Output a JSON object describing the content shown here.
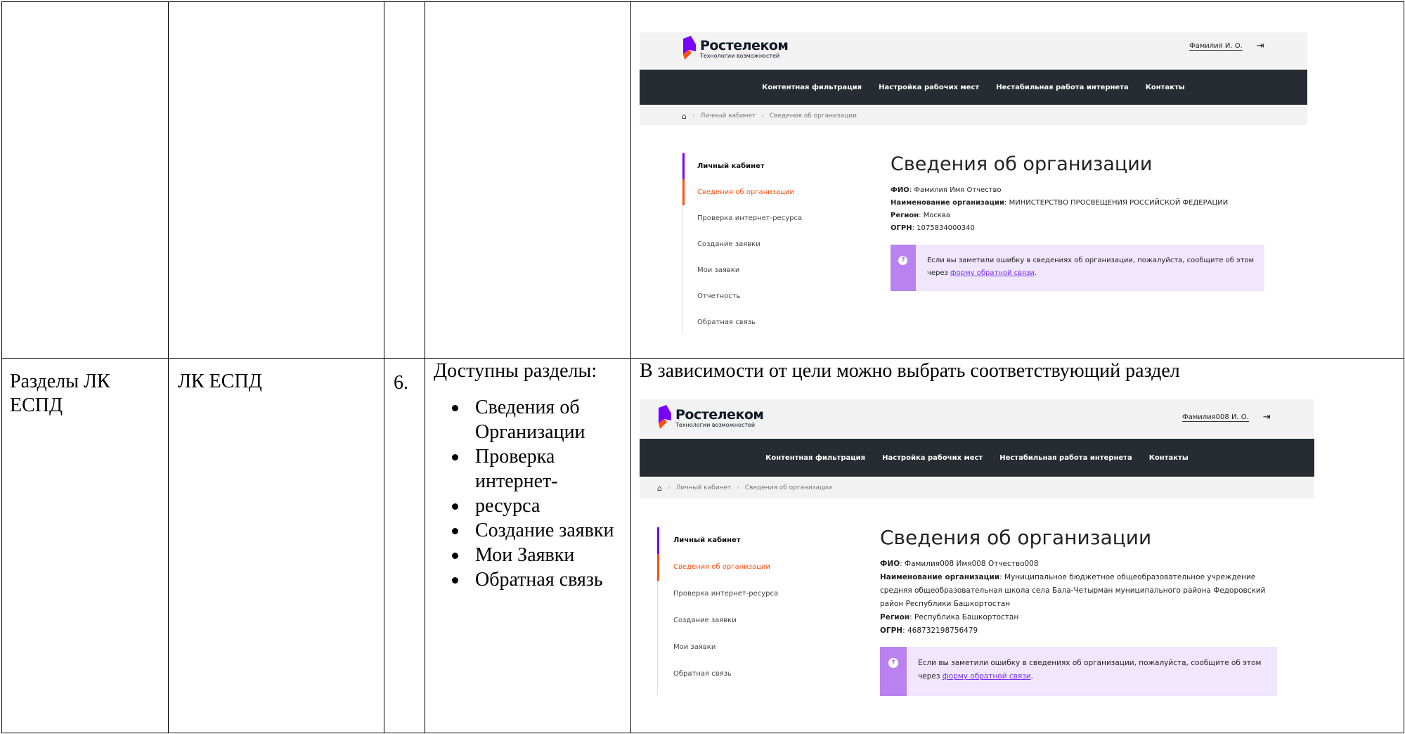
{
  "row1": {
    "shot": {
      "logo_name": "Ростелеком",
      "logo_sub": "Технологии возможностей",
      "user": "Фамилия И. О.",
      "nav": [
        "Контентная фильтрация",
        "Настройка рабочих мест",
        "Нестабильная работа интернета",
        "Контакты"
      ],
      "crumbs": [
        "Личный кабинет",
        "Сведения об организации"
      ],
      "side": [
        "Личный кабинет",
        "Сведения об организации",
        "Проверка интернет-ресурса",
        "Создание заявки",
        "Мои заявки",
        "Отчетность",
        "Обратная связь"
      ],
      "title": "Сведения об организации",
      "fields": [
        {
          "label": "ФИО",
          "value": "Фамилия Имя Отчество"
        },
        {
          "label": "Наименование организации",
          "value": "МИНИСТЕРСТВО ПРОСВЕЩЕНИЯ РОССИЙСКОЙ ФЕДЕРАЦИИ"
        },
        {
          "label": "Регион",
          "value": "Москва"
        },
        {
          "label": "ОГРН",
          "value": "1075834000340"
        }
      ],
      "note_text": "Если вы заметили ошибку в сведениях об организации, пожалуйста, сообщите об этом через ",
      "note_link": "форму обратной связи",
      "note_end": "."
    }
  },
  "row2": {
    "col1": "Разделы ЛК ЕСПД",
    "col2": "ЛК ЕСПД",
    "col3": "6.",
    "col4_heading": "Доступны разделы:",
    "col4_items": [
      "Сведения об Организации",
      "Проверка интернет-",
      "ресурса",
      "Создание заявки",
      "Мои Заявки",
      "Обратная связь"
    ],
    "col5_text": "В зависимости от цели можно выбрать соответствующий раздел",
    "shot": {
      "logo_name": "Ростелеком",
      "logo_sub": "Технологии возможностей",
      "user": "Фамилия008 И. О.",
      "nav": [
        "Контентная фильтрация",
        "Настройка рабочих мест",
        "Нестабильная работа интернета",
        "Контакты"
      ],
      "crumbs": [
        "Личный кабинет",
        "Сведения об организации"
      ],
      "side": [
        "Личный кабинет",
        "Сведения об организации",
        "Проверка интернет-ресурса",
        "Создание заявки",
        "Мои заявки",
        "Обратная связь"
      ],
      "title": "Сведения об организации",
      "fields": [
        {
          "label": "ФИО",
          "value": "Фамилия008 Имя008 Отчество008"
        },
        {
          "label": "Наименование организации",
          "value": "Муниципальное бюджетное общеобразовательное учреждение средняя общеобразовательная школа села Бала-Четырман муниципального района Федоровский район Республики Башкортостан"
        },
        {
          "label": "Регион",
          "value": "Республика Башкортостан"
        },
        {
          "label": "ОГРН",
          "value": "468732198756479"
        }
      ],
      "note_text": "Если вы заметили ошибку в сведениях об организации, пожалуйста, сообщите об этом через ",
      "note_link": "форму обратной связи",
      "note_end": "."
    }
  },
  "colors": {
    "brand_orange": "#ff4f12",
    "brand_purple": "#7700ff",
    "nav_dark": "#272c33",
    "note_bg": "#f0e6fd",
    "note_strip": "#b982f0"
  }
}
